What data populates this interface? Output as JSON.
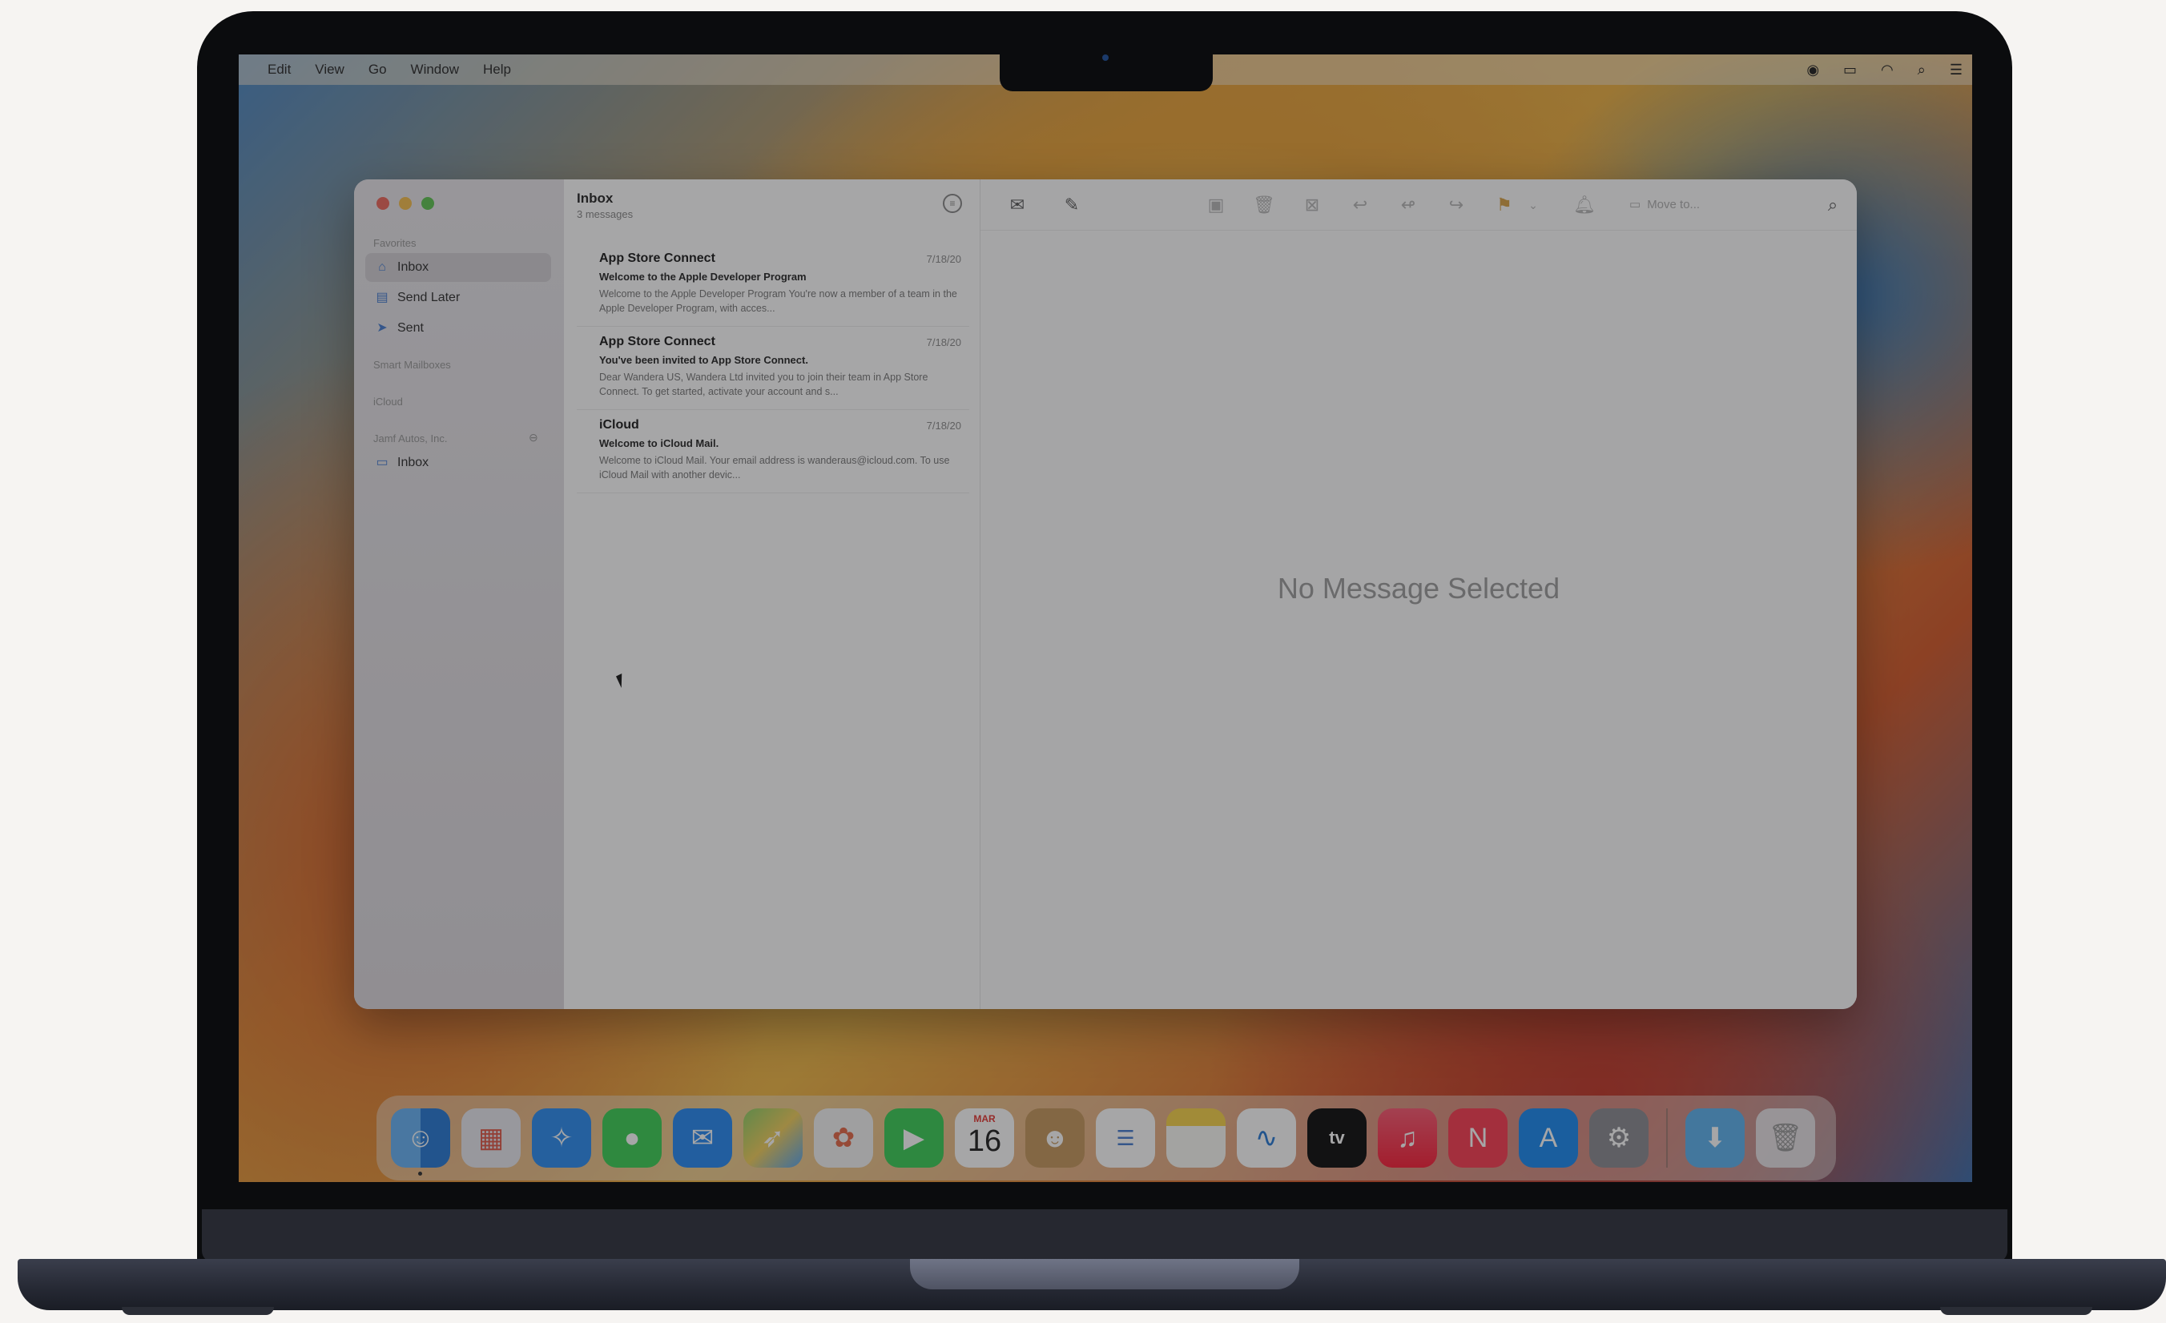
{
  "menubar": {
    "items": [
      "Edit",
      "View",
      "Go",
      "Window",
      "Help"
    ],
    "status_icons": [
      "record-icon",
      "battery-icon",
      "wifi-icon",
      "search-icon",
      "control-center-icon"
    ]
  },
  "sidebar": {
    "favorites_label": "Favorites",
    "favorites": [
      {
        "label": "Inbox",
        "icon": "tray-icon"
      },
      {
        "label": "Send Later",
        "icon": "clock-icon"
      },
      {
        "label": "Sent",
        "icon": "paperplane-icon"
      }
    ],
    "smart_mailboxes_label": "Smart Mailboxes",
    "icloud_label": "iCloud",
    "account_label": "Jamf Autos, Inc.",
    "account_items": [
      {
        "label": "Inbox",
        "icon": "folder-icon"
      }
    ]
  },
  "list": {
    "title": "Inbox",
    "subtitle": "3 messages",
    "messages": [
      {
        "from": "App Store Connect",
        "date": "7/18/20",
        "subject": "Welcome to the Apple Developer Program",
        "preview": "Welcome to the Apple Developer Program You're now a member of a team in the Apple Developer Program, with acces..."
      },
      {
        "from": "App Store Connect",
        "date": "7/18/20",
        "subject": "You've been invited to App Store Connect.",
        "preview": "Dear Wandera US, Wandera Ltd invited you to join their team in App Store Connect. To get started, activate your account and s..."
      },
      {
        "from": "iCloud",
        "date": "7/18/20",
        "subject": "Welcome to iCloud Mail.",
        "preview": "Welcome to iCloud Mail. Your email address is wanderaus@icloud.com. To use iCloud Mail with another devic..."
      }
    ]
  },
  "viewer": {
    "move_to": "Move to...",
    "empty_state": "No Message Selected"
  },
  "dock": {
    "calendar_month": "MAR",
    "calendar_day": "16",
    "apps": [
      "Finder",
      "Launchpad",
      "Safari",
      "Messages",
      "Mail",
      "Maps",
      "Photos",
      "FaceTime",
      "Calendar",
      "Contacts",
      "Reminders",
      "Notes",
      "Freeform",
      "TV",
      "Music",
      "News",
      "App Store",
      "System Settings",
      "Downloads",
      "Trash"
    ],
    "tv_label": "tv"
  },
  "colors": {
    "traffic_red": "#ed6a5e",
    "traffic_yellow": "#f5bf4f",
    "traffic_green": "#61c554",
    "accent": "#4a7fd1"
  }
}
